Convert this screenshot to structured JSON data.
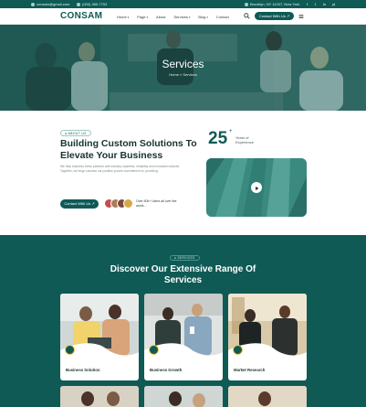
{
  "topbar": {
    "email": "consam@gmail.com",
    "phone": "(000) 480-7702",
    "address": "Brooklyn, NY 11207, New York",
    "social": [
      "f",
      "t",
      "in",
      "yt"
    ]
  },
  "header": {
    "logo": "CONSAM",
    "nav": [
      {
        "label": "Home"
      },
      {
        "label": "Page"
      },
      {
        "label": "About"
      },
      {
        "label": "Services"
      },
      {
        "label": "Blog"
      },
      {
        "label": "Contact"
      }
    ],
    "cta": "Contact With Us"
  },
  "hero": {
    "title": "Services",
    "breadcrumb_home": "Home",
    "breadcrumb_sep": "»",
    "breadcrumb_current": "Services"
  },
  "about": {
    "tag": "ABOUT US",
    "title": "Building Custom Solutions To Elevate Your Business",
    "text": "We help business thrive partners with industry expertise, reliability and innovation tailored. Together, we forge success our positive-proven commitment to, providing.",
    "cta": "Contact With Us",
    "clients_text": "Over 50k+ Users all over the world...",
    "years_value": "25",
    "years_suffix": "+",
    "years_label": "Years of Experience"
  },
  "services": {
    "tag": "SERVICES",
    "title": "Discover Our Extensive Range Of Services",
    "cards": [
      {
        "label": "Business Solution"
      },
      {
        "label": "Business Growth"
      },
      {
        "label": "Market Research"
      }
    ]
  },
  "colors": {
    "primary": "#0f5a55",
    "accent": "#f5c842",
    "white": "#ffffff"
  }
}
